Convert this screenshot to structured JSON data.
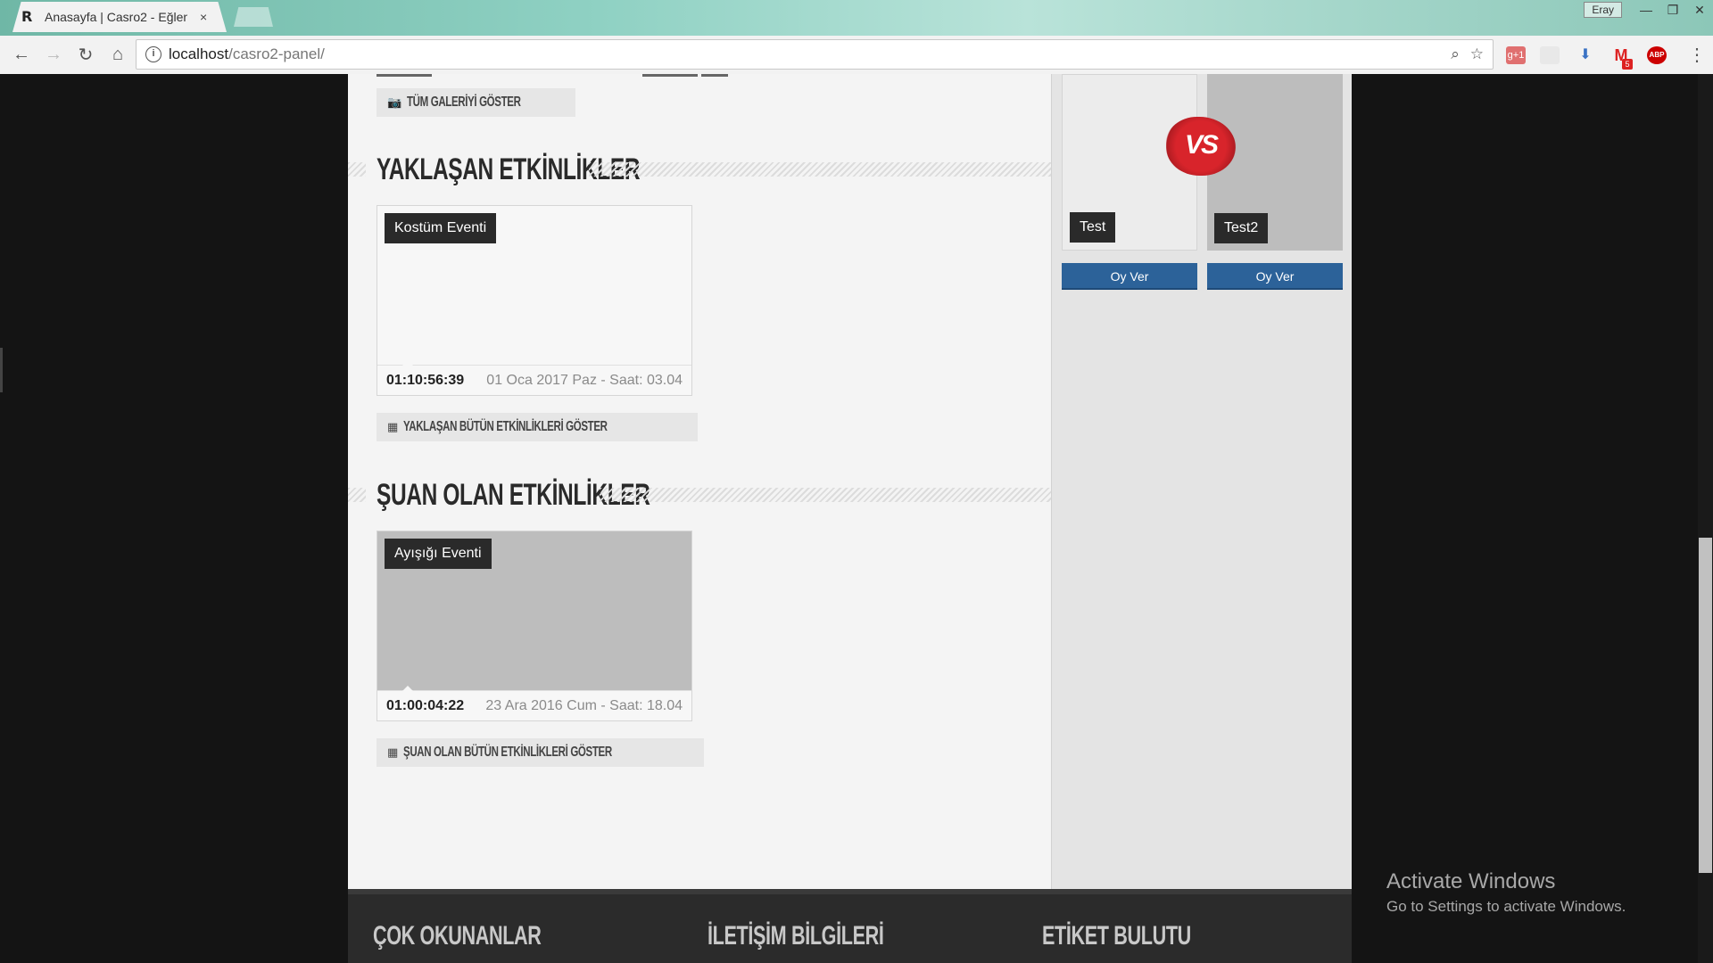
{
  "browser": {
    "tab_favicon": "R",
    "tab_title": "Anasayfa | Casro2 - Eğlen",
    "tab_close": "×",
    "user_badge": "Eray",
    "url_host": "localhost",
    "url_path": "/casro2-panel/",
    "icons": {
      "back": "back-arrow-icon",
      "forward": "forward-arrow-icon",
      "reload": "reload-icon",
      "home": "home-icon",
      "zoom": "zoom-icon",
      "bookmark": "star-icon",
      "menu": "kebab-menu-icon"
    },
    "extensions": [
      {
        "name": "google-plus-extension",
        "label": "g+1",
        "color": "#d44"
      },
      {
        "name": "blank-extension",
        "label": "",
        "color": "#ddd"
      },
      {
        "name": "translate-extension",
        "label": "⬇",
        "color": "#3a72c4"
      },
      {
        "name": "gmail-extension",
        "label": "M",
        "badge": "5",
        "color": "#d22"
      },
      {
        "name": "adblock-extension",
        "label": "ABP",
        "color": "#c00"
      }
    ]
  },
  "main": {
    "gallery_button": "TÜM GALERİYİ GÖSTER",
    "upcoming": {
      "title": "YAKLAŞAN ETKİNLİKLER",
      "event": {
        "tag": "Kostüm Eventi",
        "countdown": "01:10:56:39",
        "date": "01 Oca 2017 Paz - Saat: 03.04"
      },
      "button": "YAKLAŞAN BÜTÜN ETKİNLİKLERİ GÖSTER"
    },
    "current": {
      "title": "ŞUAN OLAN ETKİNLİKLER",
      "event": {
        "tag": "Ayışığı Eventi",
        "countdown": "01:00:04:22",
        "date": "23 Ara 2016 Cum - Saat: 18.04"
      },
      "button": "ŞUAN OLAN BÜTÜN ETKİNLİKLERİ GÖSTER"
    }
  },
  "sidebar": {
    "vs_label": "VS",
    "left": {
      "name": "Test",
      "vote": "Oy Ver"
    },
    "right": {
      "name": "Test2",
      "vote": "Oy Ver"
    }
  },
  "footer": {
    "col1": "ÇOK OKUNANLAR",
    "col2": "İLETİŞİM BİLGİLERİ",
    "col3": "ETİKET BULUTU"
  },
  "watermark": {
    "line1": "Activate Windows",
    "line2": "Go to Settings to activate Windows."
  }
}
